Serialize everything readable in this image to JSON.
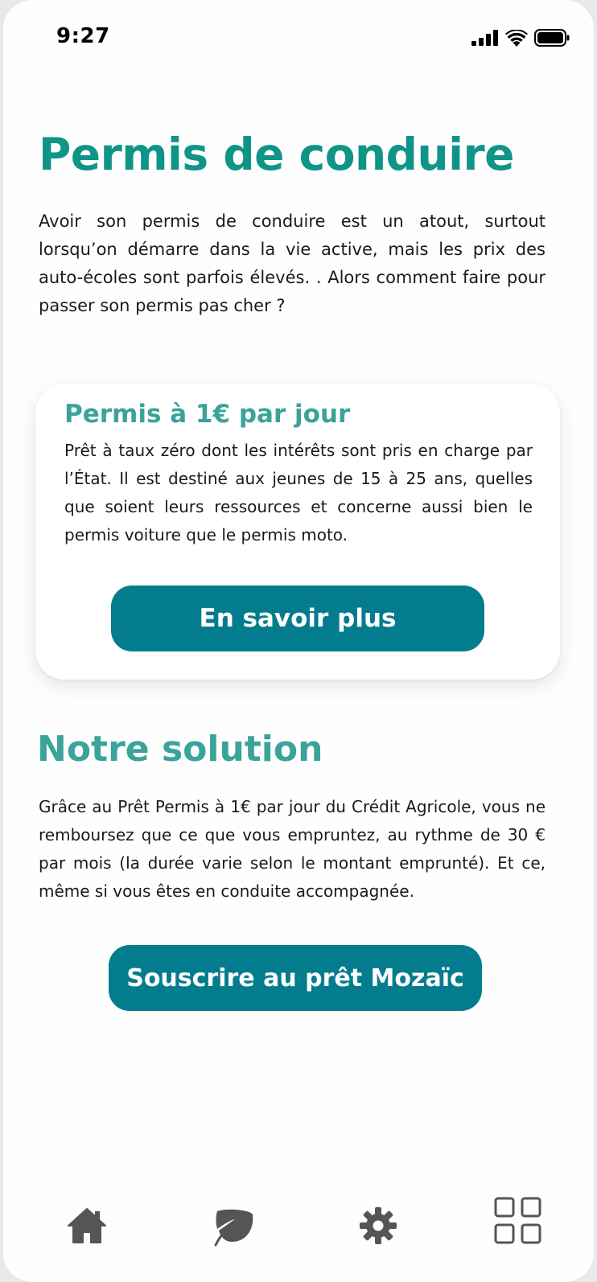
{
  "status_bar": {
    "time": "9:27"
  },
  "header": {
    "title": "Permis de conduire"
  },
  "intro": {
    "text": "Avoir son permis de conduire est un atout, surtout lorsqu’on démarre dans la vie active, mais les prix des auto-écoles sont parfois élevés. . Alors comment faire pour passer son permis pas cher ?"
  },
  "card": {
    "title": "Permis à 1€ par jour",
    "text": "Prêt à taux zéro dont les intérêts sont pris en charge par l’État. Il est destiné aux jeunes de 15 à 25 ans, quelles que soient leurs ressources et concerne aussi bien le permis voiture que le permis moto.",
    "button_label": "En savoir plus"
  },
  "solution": {
    "title": "Notre solution",
    "text": "Grâce au Prêt Permis à 1€ par jour du Crédit Agricole, vous ne remboursez que ce que vous empruntez, au rythme de 30 € par mois (la durée varie selon le montant emprunté). Et ce, même si vous êtes en conduite accompagnée.",
    "button_label": "Souscrire au prêt Mozaïc"
  },
  "bottom_nav": {
    "items": [
      {
        "icon": "home-icon"
      },
      {
        "icon": "leaf-icon"
      },
      {
        "icon": "gear-icon"
      },
      {
        "icon": "grid-icon"
      }
    ]
  },
  "colors": {
    "title": "#0f9488",
    "subtitle": "#3aa39a",
    "button": "#037d8e",
    "nav_icon": "#555555"
  }
}
